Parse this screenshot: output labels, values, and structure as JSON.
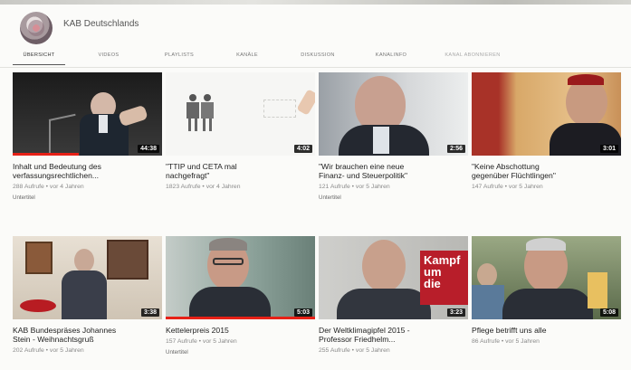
{
  "channel": {
    "name": "KAB Deutschlands"
  },
  "tabs": [
    "Übersicht",
    "Videos",
    "Playlists",
    "Kanäle",
    "Diskussion",
    "Kanalinfo",
    "Kanal abonnieren"
  ],
  "videos": [
    {
      "title_line1": "Inhalt und Bedeutung des",
      "title_line2": "verfassungsrechtlichen...",
      "meta": "288 Aufrufe • vor 4 Jahren",
      "badge": "Untertitel",
      "duration": "44:38",
      "progress": 0.44
    },
    {
      "title_line1": "\"TTIP und CETA mal",
      "title_line2": "nachgefragt\"",
      "meta": "1823 Aufrufe • vor 4 Jahren",
      "badge": "",
      "duration": "4:02",
      "progress": 0
    },
    {
      "title_line1": "\"Wir brauchen eine neue",
      "title_line2": "Finanz- und Steuerpolitik\"",
      "meta": "121 Aufrufe • vor 5 Jahren",
      "badge": "Untertitel",
      "duration": "2:56",
      "progress": 0
    },
    {
      "title_line1": "\"Keine Abschottung",
      "title_line2": "gegenüber Flüchtlingen\"",
      "meta": "147 Aufrufe • vor 5 Jahren",
      "badge": "",
      "duration": "3:01",
      "progress": 0
    },
    {
      "title_line1": "KAB Bundespräses Johannes",
      "title_line2": "Stein - Weihnachtsgruß",
      "meta": "202 Aufrufe • vor 5 Jahren",
      "badge": "",
      "duration": "3:38",
      "progress": 0
    },
    {
      "title_line1": "Kettelerpreis 2015",
      "title_line2": "",
      "meta": "157 Aufrufe • vor 5 Jahren",
      "badge": "Untertitel",
      "duration": "5:03",
      "progress": 1
    },
    {
      "title_line1": "Der Weltklimagipfel 2015 -",
      "title_line2": "Professor Friedhelm...",
      "meta": "255 Aufrufe • vor 5 Jahren",
      "badge": "",
      "duration": "3:23",
      "progress": 0
    },
    {
      "title_line1": "Pflege betrifft uns alle",
      "title_line2": "",
      "meta": "86 Aufrufe • vor 5 Jahren",
      "badge": "",
      "duration": "5:08",
      "progress": 0
    }
  ],
  "thumb_texts": {
    "sign_line1": "Kampf",
    "sign_line2": "um",
    "sign_line3": "die"
  },
  "colors": {
    "progress": "#e62117",
    "duration_bg": "#000000"
  }
}
